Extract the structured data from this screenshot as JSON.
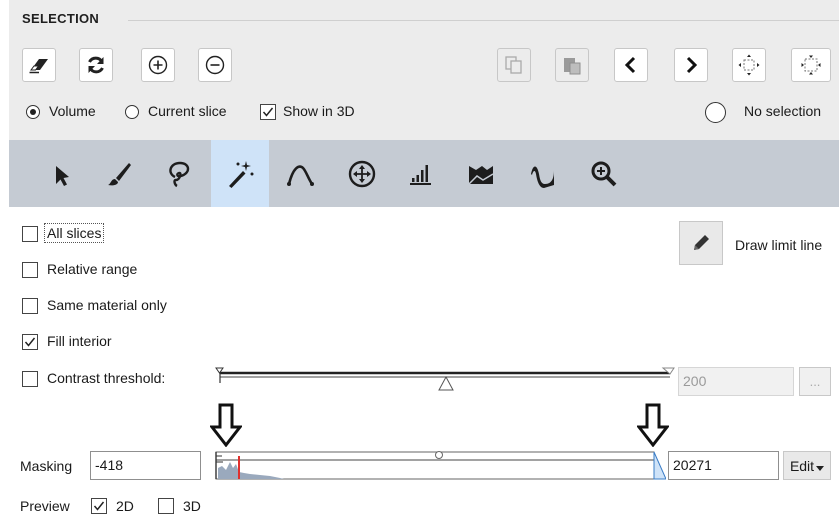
{
  "section": {
    "title": "SELECTION"
  },
  "toolbar_top": {
    "left_icons": [
      "eraser-icon",
      "refresh-icon",
      "plus-circle-icon",
      "minus-circle-icon"
    ],
    "right_icons": [
      "copy-icon",
      "paste-icon",
      "chevron-left-icon",
      "chevron-right-icon",
      "expand-selection-icon",
      "contract-selection-icon"
    ]
  },
  "scope": {
    "volume_label": "Volume",
    "current_slice_label": "Current slice",
    "show_in_3d_label": "Show in 3D",
    "no_selection_label": "No selection",
    "volume_selected": true,
    "show_in_3d_checked": true
  },
  "tools": {
    "items": [
      "pointer-tool-icon",
      "brush-tool-icon",
      "lasso-tool-icon",
      "magic-wand-tool-icon",
      "curve-tool-icon",
      "move-tool-icon",
      "threshold-tool-icon",
      "region-tool-icon",
      "fill-tool-icon",
      "zoom-tool-icon"
    ],
    "selected": "magic-wand-tool-icon"
  },
  "options": {
    "all_slices": "All slices",
    "relative_range": "Relative range",
    "same_material_only": "Same material only",
    "fill_interior": "Fill interior",
    "contrast_threshold": "Contrast threshold:",
    "fill_interior_checked": true,
    "draw_limit_line": "Draw limit line"
  },
  "contrast": {
    "value": "200",
    "more_button": "..."
  },
  "masking": {
    "label": "Masking",
    "min_value": "-418",
    "max_value": "20271",
    "edit_button": "Edit"
  },
  "preview": {
    "label": "Preview",
    "opt_2d": "2D",
    "opt_3d": "3D",
    "checked_2d": true,
    "checked_3d": false
  },
  "colors": {
    "selected_tool": "#cfe3f8",
    "toolbar_bg": "#c5cbd3",
    "histogram_fill": "#9aa9bd",
    "marker_red": "#e0302d"
  }
}
